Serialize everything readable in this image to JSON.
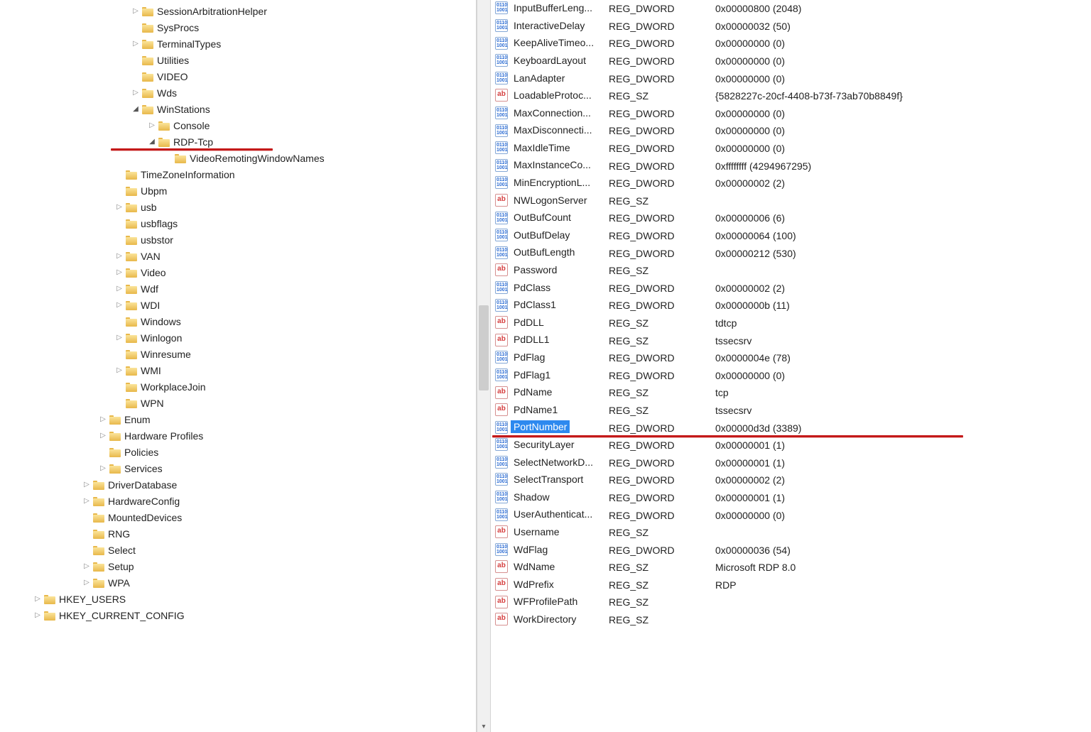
{
  "tree": [
    {
      "indent": 8,
      "toggle": "right",
      "label": "SessionArbitrationHelper"
    },
    {
      "indent": 8,
      "toggle": "none",
      "label": "SysProcs"
    },
    {
      "indent": 8,
      "toggle": "right",
      "label": "TerminalTypes"
    },
    {
      "indent": 8,
      "toggle": "none",
      "label": "Utilities"
    },
    {
      "indent": 8,
      "toggle": "none",
      "label": "VIDEO"
    },
    {
      "indent": 8,
      "toggle": "right",
      "label": "Wds"
    },
    {
      "indent": 8,
      "toggle": "down",
      "label": "WinStations"
    },
    {
      "indent": 9,
      "toggle": "right",
      "label": "Console"
    },
    {
      "indent": 9,
      "toggle": "down",
      "label": "RDP-Tcp",
      "mark": true
    },
    {
      "indent": 10,
      "toggle": "none",
      "label": "VideoRemotingWindowNames"
    },
    {
      "indent": 7,
      "toggle": "none",
      "label": "TimeZoneInformation"
    },
    {
      "indent": 7,
      "toggle": "none",
      "label": "Ubpm"
    },
    {
      "indent": 7,
      "toggle": "right",
      "label": "usb"
    },
    {
      "indent": 7,
      "toggle": "none",
      "label": "usbflags"
    },
    {
      "indent": 7,
      "toggle": "none",
      "label": "usbstor"
    },
    {
      "indent": 7,
      "toggle": "right",
      "label": "VAN"
    },
    {
      "indent": 7,
      "toggle": "right",
      "label": "Video"
    },
    {
      "indent": 7,
      "toggle": "right",
      "label": "Wdf"
    },
    {
      "indent": 7,
      "toggle": "right",
      "label": "WDI"
    },
    {
      "indent": 7,
      "toggle": "none",
      "label": "Windows"
    },
    {
      "indent": 7,
      "toggle": "right",
      "label": "Winlogon"
    },
    {
      "indent": 7,
      "toggle": "none",
      "label": "Winresume"
    },
    {
      "indent": 7,
      "toggle": "right",
      "label": "WMI"
    },
    {
      "indent": 7,
      "toggle": "none",
      "label": "WorkplaceJoin"
    },
    {
      "indent": 7,
      "toggle": "none",
      "label": "WPN"
    },
    {
      "indent": 6,
      "toggle": "right",
      "label": "Enum"
    },
    {
      "indent": 6,
      "toggle": "right",
      "label": "Hardware Profiles"
    },
    {
      "indent": 6,
      "toggle": "none",
      "label": "Policies"
    },
    {
      "indent": 6,
      "toggle": "right",
      "label": "Services"
    },
    {
      "indent": 5,
      "toggle": "right",
      "label": "DriverDatabase"
    },
    {
      "indent": 5,
      "toggle": "right",
      "label": "HardwareConfig"
    },
    {
      "indent": 5,
      "toggle": "none",
      "label": "MountedDevices"
    },
    {
      "indent": 5,
      "toggle": "none",
      "label": "RNG"
    },
    {
      "indent": 5,
      "toggle": "none",
      "label": "Select"
    },
    {
      "indent": 5,
      "toggle": "right",
      "label": "Setup"
    },
    {
      "indent": 5,
      "toggle": "right",
      "label": "WPA"
    },
    {
      "indent": 2,
      "toggle": "right",
      "label": "HKEY_USERS"
    },
    {
      "indent": 2,
      "toggle": "right",
      "label": "HKEY_CURRENT_CONFIG"
    }
  ],
  "values": [
    {
      "icon": "dword",
      "name": "InputBufferLeng...",
      "type": "REG_DWORD",
      "data": "0x00000800 (2048)"
    },
    {
      "icon": "dword",
      "name": "InteractiveDelay",
      "type": "REG_DWORD",
      "data": "0x00000032 (50)"
    },
    {
      "icon": "dword",
      "name": "KeepAliveTimeo...",
      "type": "REG_DWORD",
      "data": "0x00000000 (0)"
    },
    {
      "icon": "dword",
      "name": "KeyboardLayout",
      "type": "REG_DWORD",
      "data": "0x00000000 (0)"
    },
    {
      "icon": "dword",
      "name": "LanAdapter",
      "type": "REG_DWORD",
      "data": "0x00000000 (0)"
    },
    {
      "icon": "sz",
      "name": "LoadableProtoc...",
      "type": "REG_SZ",
      "data": "{5828227c-20cf-4408-b73f-73ab70b8849f}"
    },
    {
      "icon": "dword",
      "name": "MaxConnection...",
      "type": "REG_DWORD",
      "data": "0x00000000 (0)"
    },
    {
      "icon": "dword",
      "name": "MaxDisconnecti...",
      "type": "REG_DWORD",
      "data": "0x00000000 (0)"
    },
    {
      "icon": "dword",
      "name": "MaxIdleTime",
      "type": "REG_DWORD",
      "data": "0x00000000 (0)"
    },
    {
      "icon": "dword",
      "name": "MaxInstanceCo...",
      "type": "REG_DWORD",
      "data": "0xffffffff (4294967295)"
    },
    {
      "icon": "dword",
      "name": "MinEncryptionL...",
      "type": "REG_DWORD",
      "data": "0x00000002 (2)"
    },
    {
      "icon": "sz",
      "name": "NWLogonServer",
      "type": "REG_SZ",
      "data": ""
    },
    {
      "icon": "dword",
      "name": "OutBufCount",
      "type": "REG_DWORD",
      "data": "0x00000006 (6)"
    },
    {
      "icon": "dword",
      "name": "OutBufDelay",
      "type": "REG_DWORD",
      "data": "0x00000064 (100)"
    },
    {
      "icon": "dword",
      "name": "OutBufLength",
      "type": "REG_DWORD",
      "data": "0x00000212 (530)"
    },
    {
      "icon": "sz",
      "name": "Password",
      "type": "REG_SZ",
      "data": ""
    },
    {
      "icon": "dword",
      "name": "PdClass",
      "type": "REG_DWORD",
      "data": "0x00000002 (2)"
    },
    {
      "icon": "dword",
      "name": "PdClass1",
      "type": "REG_DWORD",
      "data": "0x0000000b (11)"
    },
    {
      "icon": "sz",
      "name": "PdDLL",
      "type": "REG_SZ",
      "data": "tdtcp"
    },
    {
      "icon": "sz",
      "name": "PdDLL1",
      "type": "REG_SZ",
      "data": "tssecsrv"
    },
    {
      "icon": "dword",
      "name": "PdFlag",
      "type": "REG_DWORD",
      "data": "0x0000004e (78)"
    },
    {
      "icon": "dword",
      "name": "PdFlag1",
      "type": "REG_DWORD",
      "data": "0x00000000 (0)"
    },
    {
      "icon": "sz",
      "name": "PdName",
      "type": "REG_SZ",
      "data": "tcp"
    },
    {
      "icon": "sz",
      "name": "PdName1",
      "type": "REG_SZ",
      "data": "tssecsrv"
    },
    {
      "icon": "dword",
      "name": "PortNumber",
      "type": "REG_DWORD",
      "data": "0x00000d3d (3389)",
      "selected": true,
      "mark": true
    },
    {
      "icon": "dword",
      "name": "SecurityLayer",
      "type": "REG_DWORD",
      "data": "0x00000001 (1)"
    },
    {
      "icon": "dword",
      "name": "SelectNetworkD...",
      "type": "REG_DWORD",
      "data": "0x00000001 (1)"
    },
    {
      "icon": "dword",
      "name": "SelectTransport",
      "type": "REG_DWORD",
      "data": "0x00000002 (2)"
    },
    {
      "icon": "dword",
      "name": "Shadow",
      "type": "REG_DWORD",
      "data": "0x00000001 (1)"
    },
    {
      "icon": "dword",
      "name": "UserAuthenticat...",
      "type": "REG_DWORD",
      "data": "0x00000000 (0)"
    },
    {
      "icon": "sz",
      "name": "Username",
      "type": "REG_SZ",
      "data": ""
    },
    {
      "icon": "dword",
      "name": "WdFlag",
      "type": "REG_DWORD",
      "data": "0x00000036 (54)"
    },
    {
      "icon": "sz",
      "name": "WdName",
      "type": "REG_SZ",
      "data": "Microsoft RDP 8.0"
    },
    {
      "icon": "sz",
      "name": "WdPrefix",
      "type": "REG_SZ",
      "data": "RDP"
    },
    {
      "icon": "sz",
      "name": "WFProfilePath",
      "type": "REG_SZ",
      "data": ""
    },
    {
      "icon": "sz",
      "name": "WorkDirectory",
      "type": "REG_SZ",
      "data": ""
    }
  ]
}
